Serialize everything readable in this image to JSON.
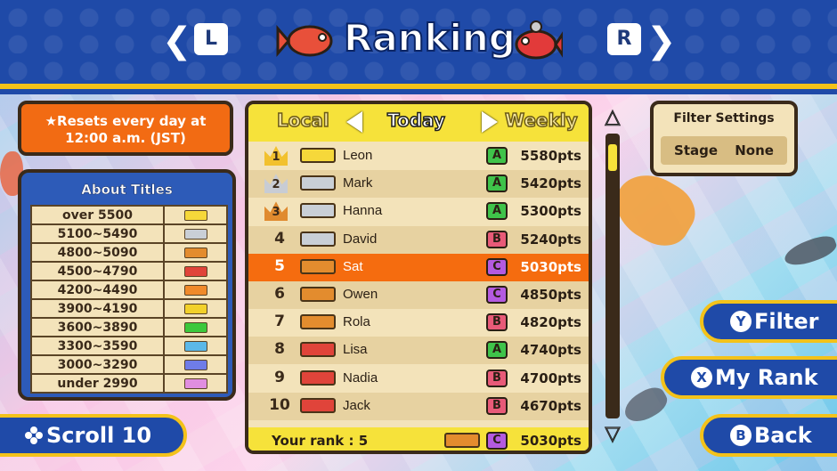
{
  "header": {
    "title": "Ranking",
    "left_key": "L",
    "right_key": "R"
  },
  "left": {
    "reset_notice": "★Resets every day at 12:00 a.m. (JST)",
    "titles_heading": "About Titles",
    "titles": [
      {
        "range": "over 5500",
        "color": "#f6d83a"
      },
      {
        "range": "5100~5490",
        "color": "#c9cfd6"
      },
      {
        "range": "4800~5090",
        "color": "#e38c2e"
      },
      {
        "range": "4500~4790",
        "color": "#e0443a"
      },
      {
        "range": "4200~4490",
        "color": "#f08a2a"
      },
      {
        "range": "3900~4190",
        "color": "#f2d12a"
      },
      {
        "range": "3600~3890",
        "color": "#3cc83c"
      },
      {
        "range": "3300~3590",
        "color": "#5bb8e8"
      },
      {
        "range": "3000~3290",
        "color": "#6f7ce8"
      },
      {
        "range": "under 2990",
        "color": "#e08ee0"
      }
    ]
  },
  "ranking": {
    "tab_left": "Local",
    "tab_current": "Today",
    "tab_right": "Weekly",
    "rows": [
      {
        "rank": "1",
        "name": "Leon",
        "grade": "A",
        "points": "5580pts",
        "crown": "gold",
        "title_color": "#f6d83a"
      },
      {
        "rank": "2",
        "name": "Mark",
        "grade": "A",
        "points": "5420pts",
        "crown": "silver",
        "title_color": "#c9cfd6"
      },
      {
        "rank": "3",
        "name": "Hanna",
        "grade": "A",
        "points": "5300pts",
        "crown": "bronze",
        "title_color": "#c9cfd6"
      },
      {
        "rank": "4",
        "name": "David",
        "grade": "B",
        "points": "5240pts",
        "crown": "",
        "title_color": "#c9cfd6"
      },
      {
        "rank": "5",
        "name": "Sat",
        "grade": "C",
        "points": "5030pts",
        "crown": "",
        "title_color": "#e38c2e"
      },
      {
        "rank": "6",
        "name": "Owen",
        "grade": "C",
        "points": "4850pts",
        "crown": "",
        "title_color": "#e38c2e"
      },
      {
        "rank": "7",
        "name": "Rola",
        "grade": "B",
        "points": "4820pts",
        "crown": "",
        "title_color": "#e38c2e"
      },
      {
        "rank": "8",
        "name": "Lisa",
        "grade": "A",
        "points": "4740pts",
        "crown": "",
        "title_color": "#e0443a"
      },
      {
        "rank": "9",
        "name": "Nadia",
        "grade": "B",
        "points": "4700pts",
        "crown": "",
        "title_color": "#e0443a"
      },
      {
        "rank": "10",
        "name": "Jack",
        "grade": "B",
        "points": "4670pts",
        "crown": "",
        "title_color": "#e0443a"
      }
    ],
    "highlight_rank": "5",
    "your_rank_label": "Your rank : 5",
    "your_grade": "C",
    "your_points": "5030pts",
    "grade_colors": {
      "A": "#3fc34a",
      "B": "#e85a78",
      "C": "#b45ae0"
    },
    "crown_colors": {
      "gold": "#f2c12e",
      "silver": "#c8ccd4",
      "bronze": "#e08a2e"
    }
  },
  "filter": {
    "title": "Filter Settings",
    "value": "Stage None"
  },
  "buttons": {
    "filter": {
      "key": "Y",
      "label": "Filter"
    },
    "my_rank": {
      "key": "X",
      "label": "My Rank"
    },
    "back": {
      "key": "B",
      "label": "Back"
    },
    "scroll": {
      "label": "Scroll 10"
    }
  },
  "scrollbar": {
    "position": 0.02
  }
}
